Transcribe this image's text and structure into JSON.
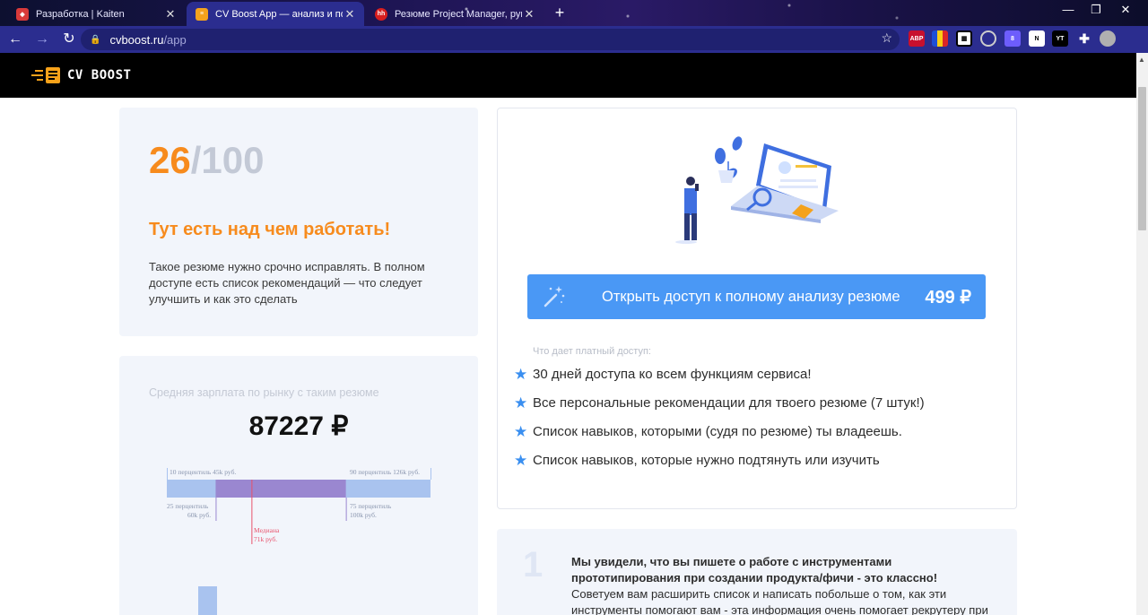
{
  "browser": {
    "tabs": [
      {
        "title": "Разработка | Kaiten",
        "favicon_color": "#d93a3a"
      },
      {
        "title": "CV Boost App — анализ и повышение",
        "favicon_color": "#f4a21d"
      },
      {
        "title": "Резюме Project Manager, руководитель",
        "favicon_color": "#d81e1e",
        "favicon_text": "hh"
      }
    ],
    "url_host": "cvboost.ru",
    "url_path": "/app",
    "extensions": [
      "ABP",
      "",
      "",
      "",
      "8",
      "N",
      "YT",
      "",
      ""
    ]
  },
  "site": {
    "logo_text": "CV BOOST"
  },
  "score": {
    "value": "26",
    "separator": "/",
    "max": "100",
    "verdict": "Тут есть над чем работать!",
    "description": "Такое резюме нужно срочно исправлять. В полном доступе есть список рекомендаций — что следует улучшить и как это сделать"
  },
  "salary": {
    "label": "Средняя зарплата по рынку с таким резюме",
    "value": "87227 ₽",
    "chart_data": {
      "type": "box",
      "unit": "k руб.",
      "p10": 45,
      "p25": 60,
      "median": 71,
      "p75": 100,
      "p90": 126,
      "labels": {
        "p10": "10 перцентиль 45k руб.",
        "p90": "90 перцентиль 126k руб.",
        "p25_line1": "25 перцентиль",
        "p25_line2": "60k руб.",
        "p75_line1": "75 перцентиль",
        "p75_line2": "100k руб.",
        "median_line1": "Медиана",
        "median_line2": "71k руб."
      },
      "colors": {
        "outer": "#a9c3ef",
        "inner": "#9a87d0",
        "median": "#e8516b"
      }
    }
  },
  "offer": {
    "cta_label": "Открыть доступ к полному анализу резюме",
    "cta_price": "499 ₽",
    "benefits_title": "Что дает платный доступ:",
    "benefits": [
      "30 дней доступа ко всем функциям сервиса!",
      "Все персональные рекомендации для твоего резюме (7 штук!)",
      "Список навыков, которыми (судя по резюме) ты владеешь.",
      "Список навыков, которые нужно подтянуть или изучить"
    ]
  },
  "recommendation": {
    "number": "1",
    "bold_text": "Мы увидели, что вы пишете о работе с инструментами прототипирования при создании продукта/фичи - это классно!",
    "text": " Советуем вам расширить список и написать побольше о том, как эти инструменты помогают вам - эта информация очень помогает рекрутеру при отборе"
  },
  "colors": {
    "accent_orange": "#f78b1d",
    "cta_blue": "#4a98f5",
    "star_blue": "#3a8ff0"
  }
}
